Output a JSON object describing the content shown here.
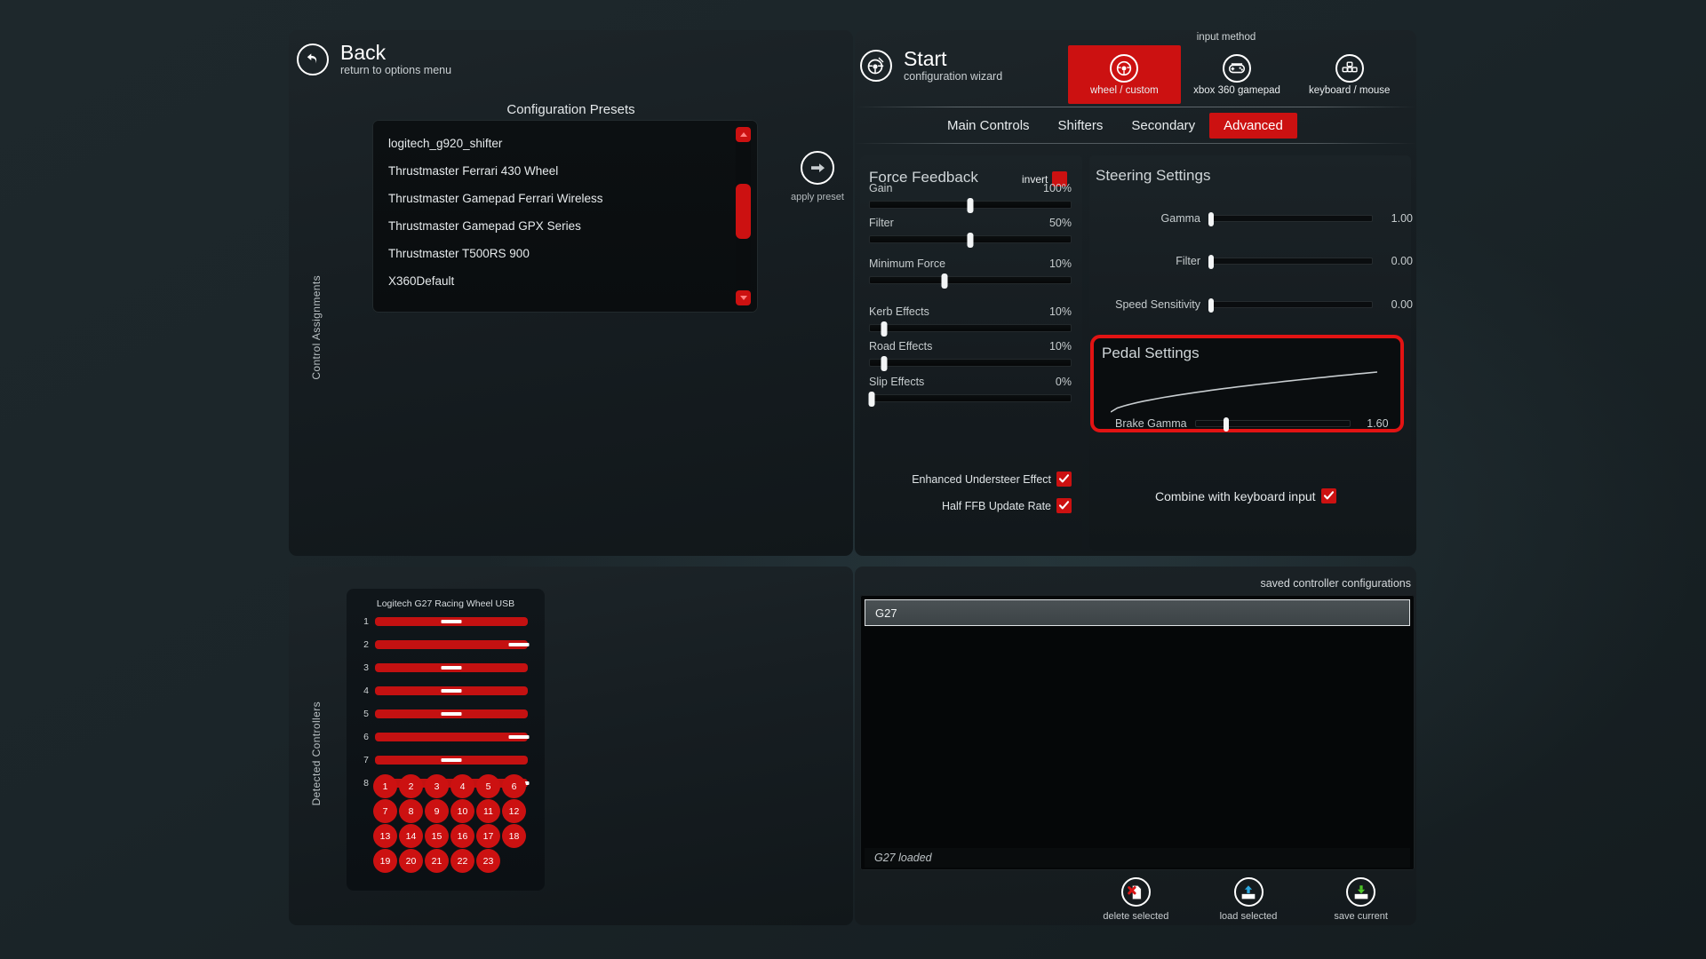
{
  "back": {
    "title": "Back",
    "subtitle": "return to options menu",
    "icon": "back-arrow-icon"
  },
  "start": {
    "title": "Start",
    "subtitle": "configuration wizard",
    "icon": "steering-wheel-wand-icon"
  },
  "sections": {
    "control_assignments": "Control Assignments",
    "detected_controllers": "Detected Controllers"
  },
  "presets": {
    "title": "Configuration Presets",
    "items": [
      "logitech_g920_shifter",
      "Thrustmaster Ferrari 430 Wheel",
      "Thrustmaster Gamepad Ferrari Wireless",
      "Thrustmaster Gamepad GPX Series",
      "Thrustmaster T500RS 900",
      "X360Default"
    ],
    "apply_label": "apply preset",
    "scrollbar": {
      "thumb_top_pct": 28,
      "thumb_height_pct": 31
    }
  },
  "input_method": {
    "label": "input method",
    "options": [
      {
        "label": "wheel / custom",
        "icon": "steering-wheel-icon",
        "selected": true
      },
      {
        "label": "xbox 360 gamepad",
        "icon": "gamepad-icon",
        "selected": false
      },
      {
        "label": "keyboard / mouse",
        "icon": "keyboard-mouse-icon",
        "selected": false
      }
    ]
  },
  "tabs": [
    {
      "label": "Main Controls",
      "active": false
    },
    {
      "label": "Shifters",
      "active": false
    },
    {
      "label": "Secondary",
      "active": false
    },
    {
      "label": "Advanced",
      "active": true
    }
  ],
  "force_feedback": {
    "title": "Force Feedback",
    "invert_label": "invert",
    "invert_checked": false,
    "sliders": [
      {
        "label": "Gain",
        "value": "100%",
        "pct": 50
      },
      {
        "label": "Filter",
        "value": "50%",
        "pct": 50
      },
      {
        "label": "Minimum Force",
        "value": "10%",
        "pct": 37
      },
      {
        "label": "Kerb Effects",
        "value": "10%",
        "pct": 7
      },
      {
        "label": "Road Effects",
        "value": "10%",
        "pct": 7
      },
      {
        "label": "Slip Effects",
        "value": "0%",
        "pct": 1
      }
    ],
    "checkboxes": [
      {
        "label": "Enhanced Understeer Effect",
        "checked": true
      },
      {
        "label": "Half FFB Update Rate",
        "checked": true
      }
    ]
  },
  "steering": {
    "title": "Steering Settings",
    "sliders": [
      {
        "label": "Gamma",
        "value": "1.00",
        "pct": 1
      },
      {
        "label": "Filter",
        "value": "0.00",
        "pct": 1
      },
      {
        "label": "Speed Sensitivity",
        "value": "0.00",
        "pct": 1
      }
    ]
  },
  "pedal": {
    "title": "Pedal Settings",
    "brake_label": "Brake Gamma",
    "brake_value": "1.60",
    "brake_pct": 20,
    "curve_gamma": 1.6,
    "highlighted": true
  },
  "combine": {
    "label": "Combine with keyboard input",
    "checked": true
  },
  "detected_controller": {
    "name": "Logitech G27 Racing Wheel USB",
    "axes": [
      {
        "num": "1",
        "pct": 50
      },
      {
        "num": "2",
        "pct": 94
      },
      {
        "num": "3",
        "pct": 50
      },
      {
        "num": "4",
        "pct": 50
      },
      {
        "num": "5",
        "pct": 50
      },
      {
        "num": "6",
        "pct": 94
      },
      {
        "num": "7",
        "pct": 50
      },
      {
        "num": "8",
        "pct": 94
      }
    ],
    "buttons": [
      "1",
      "2",
      "3",
      "4",
      "5",
      "6",
      "7",
      "8",
      "9",
      "10",
      "11",
      "12",
      "13",
      "14",
      "15",
      "16",
      "17",
      "18",
      "19",
      "20",
      "21",
      "22",
      "23"
    ]
  },
  "saved_configs": {
    "label": "saved controller configurations",
    "items": [
      "G27"
    ],
    "selected": "G27",
    "status": "G27 loaded",
    "actions": [
      {
        "label": "delete selected",
        "icon": "delete-file-icon"
      },
      {
        "label": "load selected",
        "icon": "load-tray-icon"
      },
      {
        "label": "save current",
        "icon": "save-tray-icon"
      }
    ]
  },
  "colors": {
    "accent_red": "#cc1111",
    "highlight_red": "#e21313",
    "bg": "#1b2529"
  }
}
